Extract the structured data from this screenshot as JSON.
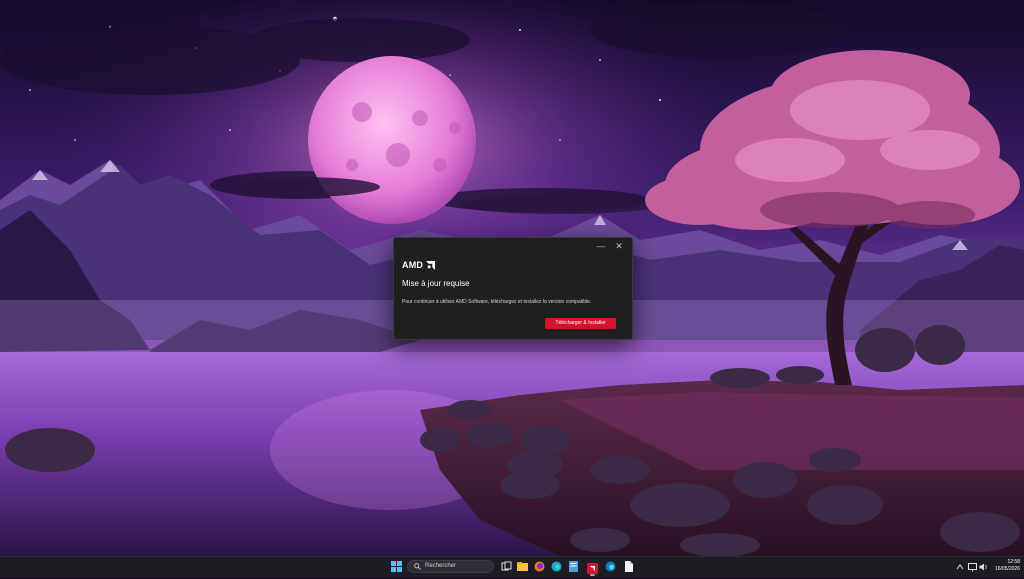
{
  "dialog": {
    "brand": "AMD",
    "minimize_glyph": "—",
    "close_glyph": "✕",
    "title": "Mise à jour requise",
    "message": "Pour continuer à utiliser AMD Software, téléchargez et installez la version compatible.",
    "action_label": "Télécharger & Installer",
    "accent_color": "#d4142a"
  },
  "taskbar": {
    "search_placeholder": "Rechercher",
    "apps": [
      "task-view-icon",
      "file-explorer-icon",
      "firefox-icon",
      "edge-icon",
      "notepad-icon",
      "amd-software-icon",
      "edge-icon",
      "file-icon"
    ],
    "tray_icons": [
      "chevron-up-icon",
      "network-icon",
      "volume-icon"
    ],
    "time": "12:58",
    "date": "16/05/2026"
  },
  "colors": {
    "taskbar_bg": "#1c1c22",
    "dialog_bg": "#1f1f1f",
    "wallpaper_sky": "#2a1650",
    "moon": "#e78ad8",
    "tree": "#c2609e"
  }
}
